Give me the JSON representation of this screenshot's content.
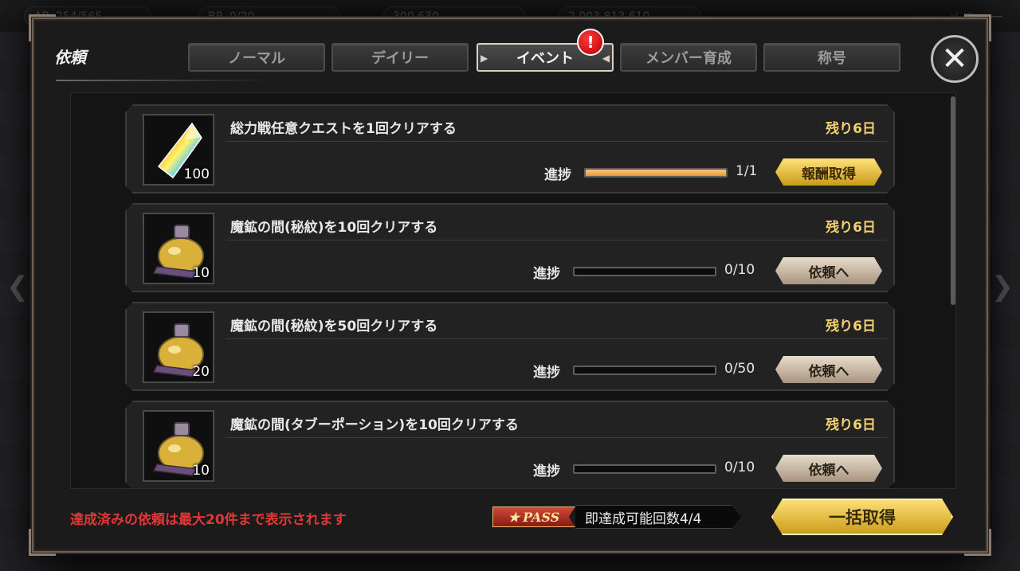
{
  "background": {
    "top_stats": [
      "AP",
      "254/565",
      "BP",
      "0/20",
      "300,630",
      "2,003,813,610"
    ],
    "menu_label": "メニュー"
  },
  "modal": {
    "title": "依頼",
    "tabs": [
      {
        "label": "ノーマル",
        "active": false
      },
      {
        "label": "デイリー",
        "active": false
      },
      {
        "label": "イベント",
        "active": true
      },
      {
        "label": "メンバー育成",
        "active": false
      },
      {
        "label": "称号",
        "active": false
      }
    ],
    "alert_glyph": "!",
    "close_glyph": "✕"
  },
  "quests": [
    {
      "title": "総力戦任意クエストを1回クリアする",
      "remaining": "残り6日",
      "reward_icon": "crystal-icon",
      "reward_qty": "100",
      "progress_label": "進捗",
      "progress_text": "1/1",
      "progress_fraction": 1.0,
      "button_label": "報酬取得",
      "button_style": "gold"
    },
    {
      "title": "魔鉱の間(秘紋)を10回クリアする",
      "remaining": "残り6日",
      "reward_icon": "potion-icon",
      "reward_qty": "10",
      "progress_label": "進捗",
      "progress_text": "0/10",
      "progress_fraction": 0.0,
      "button_label": "依頼へ",
      "button_style": "beige"
    },
    {
      "title": "魔鉱の間(秘紋)を50回クリアする",
      "remaining": "残り6日",
      "reward_icon": "potion-icon",
      "reward_qty": "20",
      "progress_label": "進捗",
      "progress_text": "0/50",
      "progress_fraction": 0.0,
      "button_label": "依頼へ",
      "button_style": "beige"
    },
    {
      "title": "魔鉱の間(タブーポーション)を10回クリアする",
      "remaining": "残り6日",
      "reward_icon": "potion-icon",
      "reward_qty": "10",
      "progress_label": "進捗",
      "progress_text": "0/10",
      "progress_fraction": 0.0,
      "button_label": "依頼へ",
      "button_style": "beige"
    }
  ],
  "footer": {
    "note": "達成済みの依頼は最大20件まで表示されます",
    "pass_label": "PASS",
    "pass_count": "即達成可能回数4/4",
    "bulk_button": "一括取得"
  },
  "colors": {
    "accent_gold": "#f0d070",
    "alert_red": "#e33636",
    "progress_fill": "#e29a3a"
  }
}
